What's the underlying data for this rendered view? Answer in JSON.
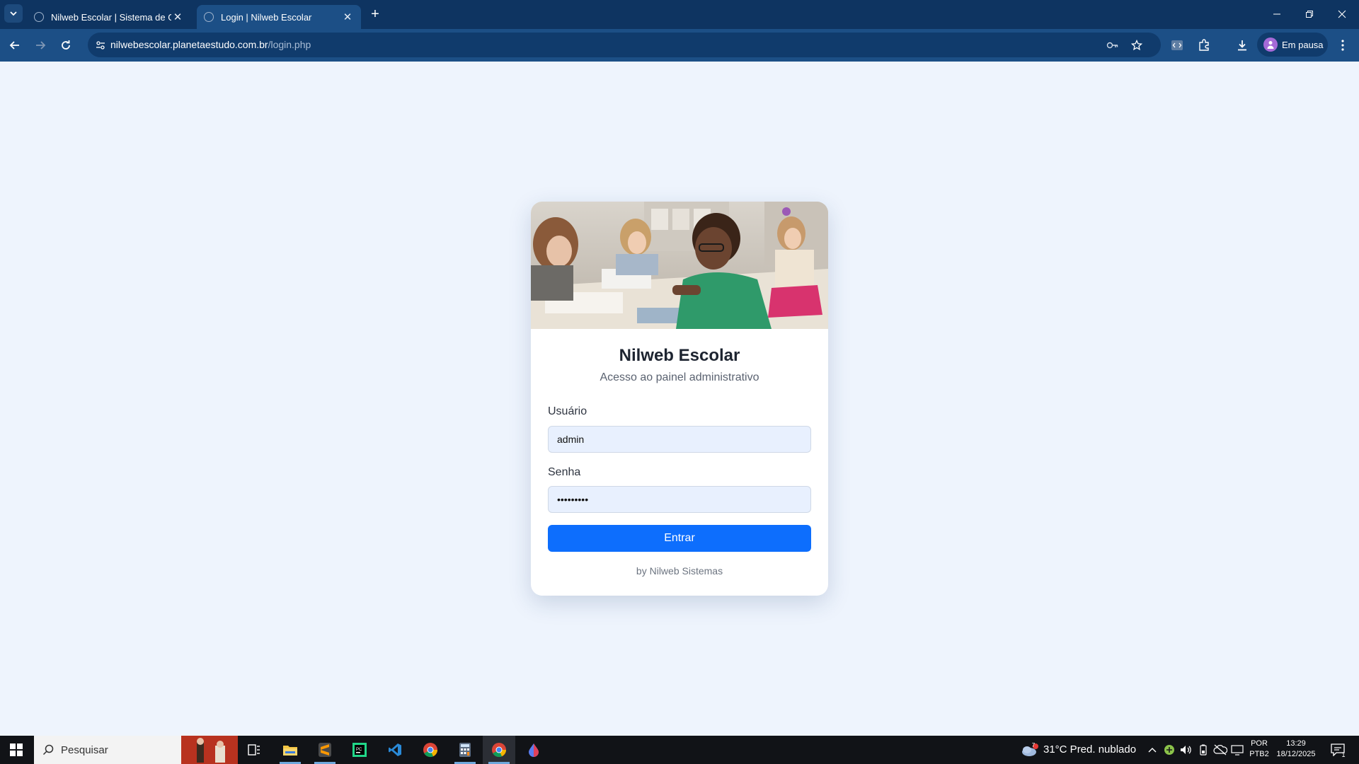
{
  "browser": {
    "tabs": [
      {
        "title": "Nilweb Escolar | Sistema de Ges",
        "active": false
      },
      {
        "title": "Login | Nilweb Escolar",
        "active": true
      }
    ],
    "url_host": "nilwebescolar.planetaestudo.com.br",
    "url_path": "/login.php",
    "profile_label": "Em pausa"
  },
  "login": {
    "title": "Nilweb Escolar",
    "subtitle": "Acesso ao painel administrativo",
    "username_label": "Usuário",
    "username_value": "admin",
    "password_label": "Senha",
    "password_value": "admin1234",
    "submit_label": "Entrar",
    "credit": "by Nilweb Sistemas"
  },
  "taskbar": {
    "search_placeholder": "Pesquisar",
    "weather_badge": "7",
    "weather": "31°C  Pred. nublado",
    "language_top": "POR",
    "language_bottom": "PTB2",
    "time": "13:29",
    "date": "18/12/2025",
    "notification_count": "1"
  },
  "colors": {
    "page_background": "#eef4fd",
    "accent": "#0d6efd",
    "chrome_dark": "#0e3461",
    "chrome_toolbar": "#1c4f86"
  }
}
